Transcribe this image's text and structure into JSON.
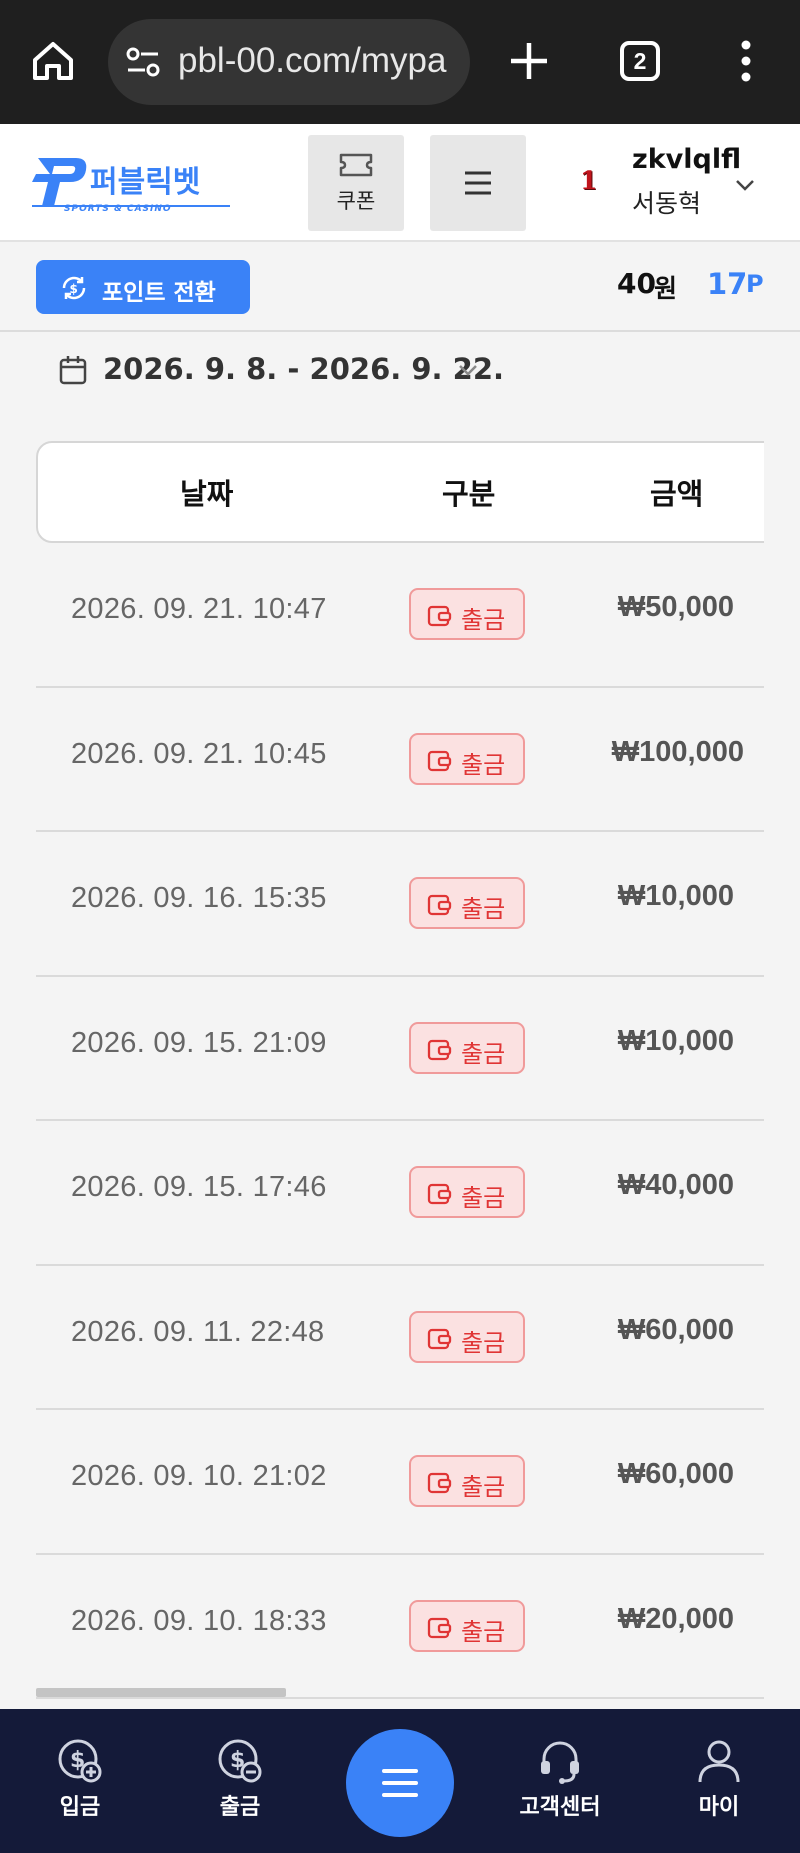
{
  "browser": {
    "url": "pbl-00.com/mypa",
    "tab_count": "2"
  },
  "header": {
    "logo_text": "퍼블릭벳",
    "logo_subtext": "SPORTS & CASINO",
    "coupon_label": "쿠폰",
    "level": "1",
    "username": "zkvlqlfl",
    "realname": "서동혁"
  },
  "points_bar": {
    "convert_label": "포인트 전환",
    "balance": "40",
    "balance_unit": "원",
    "points": "17",
    "points_unit": "P"
  },
  "filter": {
    "date_range": "2026. 9. 8. - 2026. 9. 22."
  },
  "table": {
    "headers": {
      "date": "날짜",
      "type": "구분",
      "amount": "금액"
    },
    "rows": [
      {
        "date": "2026. 09. 21. 10:47",
        "type": "출금",
        "amount": "₩50,000"
      },
      {
        "date": "2026. 09. 21. 10:45",
        "type": "출금",
        "amount": "₩100,000"
      },
      {
        "date": "2026. 09. 16. 15:35",
        "type": "출금",
        "amount": "₩10,000"
      },
      {
        "date": "2026. 09. 15. 21:09",
        "type": "출금",
        "amount": "₩10,000"
      },
      {
        "date": "2026. 09. 15. 17:46",
        "type": "출금",
        "amount": "₩40,000"
      },
      {
        "date": "2026. 09. 11. 22:48",
        "type": "출금",
        "amount": "₩60,000"
      },
      {
        "date": "2026. 09. 10. 21:02",
        "type": "출금",
        "amount": "₩60,000"
      },
      {
        "date": "2026. 09. 10. 18:33",
        "type": "출금",
        "amount": "₩20,000"
      }
    ]
  },
  "bottom_nav": {
    "deposit": "입금",
    "withdraw": "출금",
    "support": "고객센터",
    "my": "마이"
  },
  "colors": {
    "accent": "#3a82f7",
    "nav_bg": "#141a39",
    "badge_red": "#e03535",
    "level_red": "#c0141c"
  }
}
